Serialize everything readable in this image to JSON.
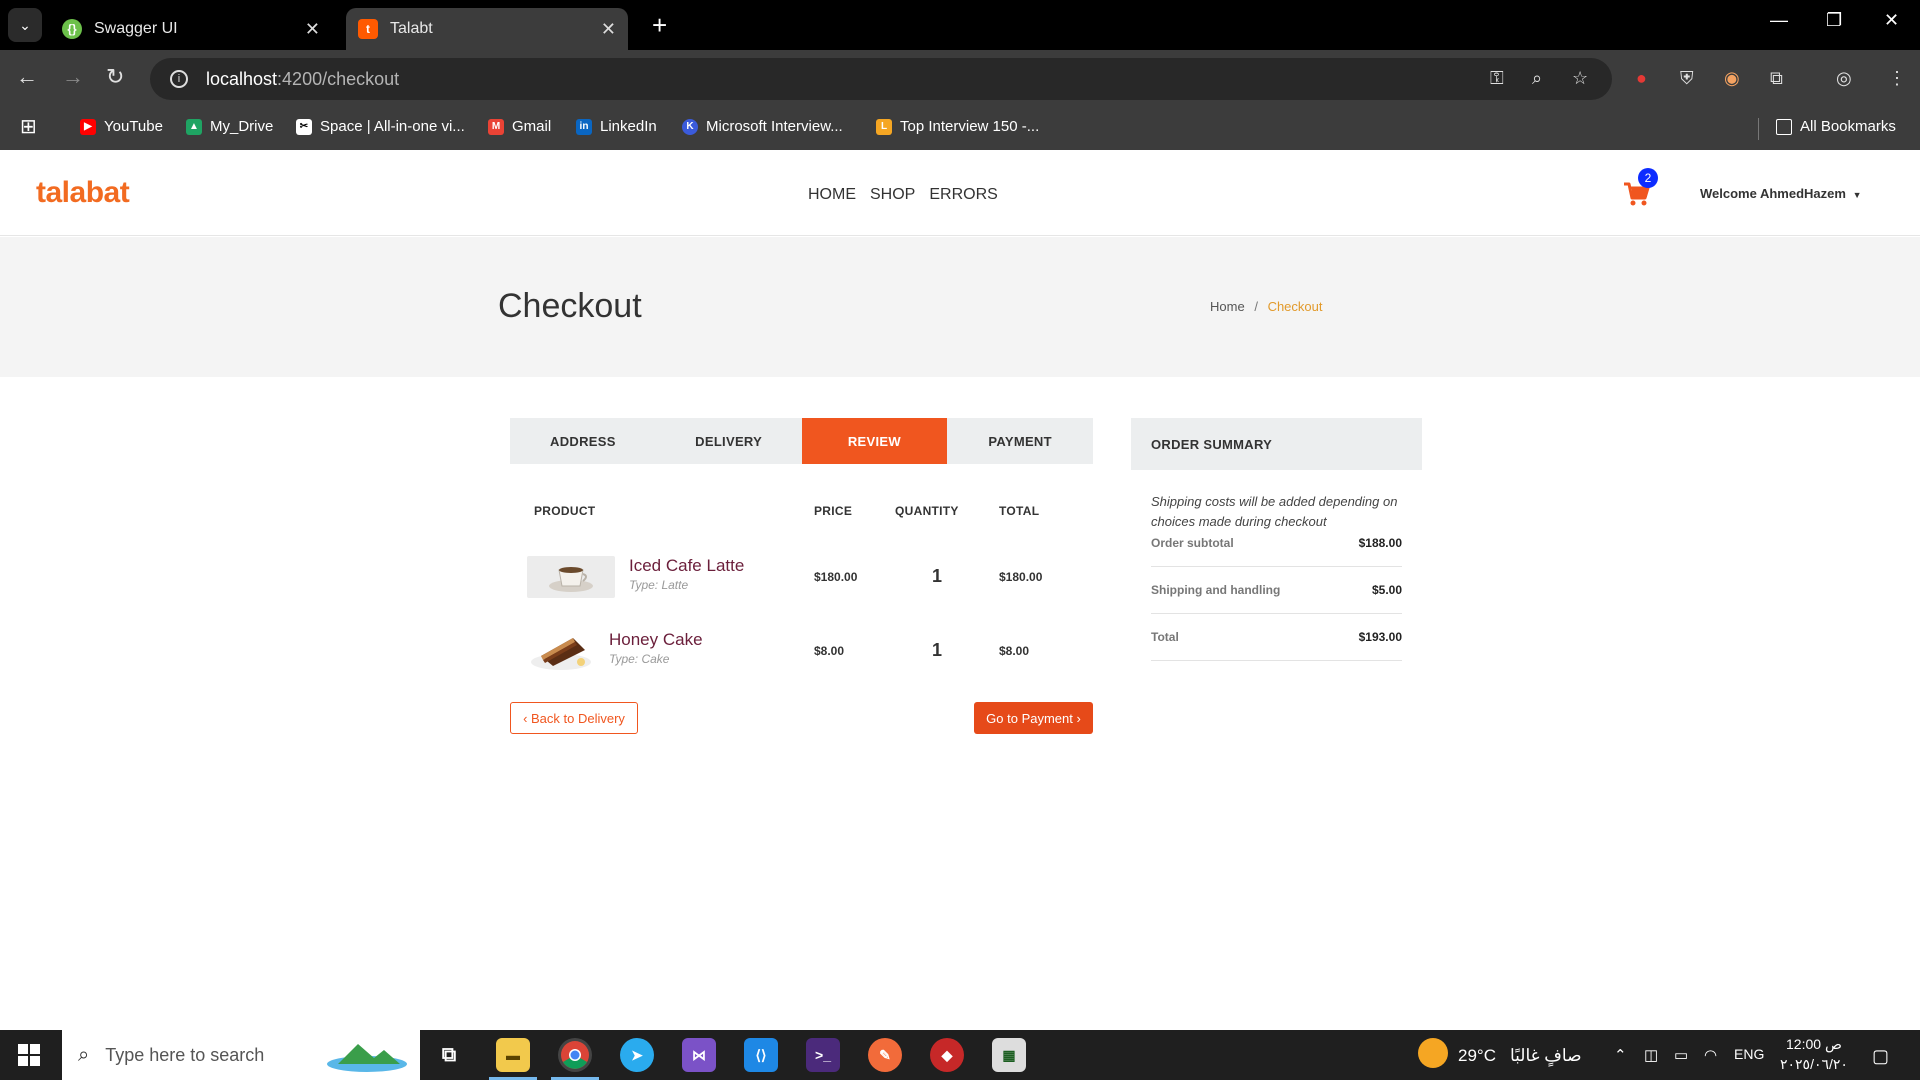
{
  "browser": {
    "tabs": [
      {
        "title": "Swagger UI",
        "active": false
      },
      {
        "title": "Talabt",
        "active": true
      }
    ],
    "url_host": "localhost",
    "url_path": ":4200/checkout",
    "bookmarks": [
      {
        "label": "YouTube",
        "color": "#ff0000"
      },
      {
        "label": "My_Drive",
        "color": "#1fa463"
      },
      {
        "label": "Space | All-in-one vi...",
        "color": "#ffffff"
      },
      {
        "label": "Gmail",
        "color": "#ea4335"
      },
      {
        "label": "LinkedIn",
        "color": "#0a66c2"
      },
      {
        "label": "Microsoft Interview...",
        "color": "#3b5bdb"
      },
      {
        "label": "Top Interview 150 -...",
        "color": "#f5a623"
      }
    ],
    "all_bookmarks": "All Bookmarks"
  },
  "site": {
    "logo": "talabat",
    "nav": [
      "HOME",
      "SHOP",
      "ERRORS"
    ],
    "cart_count": "2",
    "welcome": "Welcome AhmedHazem"
  },
  "hero": {
    "title": "Checkout",
    "breadcrumb_home": "Home",
    "breadcrumb_sep": "/",
    "breadcrumb_current": "Checkout"
  },
  "steps": [
    {
      "label": "ADDRESS",
      "active": false
    },
    {
      "label": "DELIVERY",
      "active": false
    },
    {
      "label": "REVIEW",
      "active": true
    },
    {
      "label": "PAYMENT",
      "active": false
    }
  ],
  "table": {
    "headers": {
      "product": "PRODUCT",
      "price": "PRICE",
      "quantity": "QUANTITY",
      "total": "TOTAL"
    },
    "items": [
      {
        "name": "Iced Cafe Latte",
        "type": "Type: Latte",
        "price": "$180.00",
        "quantity": "1",
        "total": "$180.00"
      },
      {
        "name": "Honey Cake",
        "type": "Type: Cake",
        "price": "$8.00",
        "quantity": "1",
        "total": "$8.00"
      }
    ]
  },
  "buttons": {
    "back": "‹ Back to Delivery",
    "next": "Go to Payment ›"
  },
  "summary": {
    "title": "ORDER SUMMARY",
    "note": "Shipping costs will be added depending on choices made during checkout",
    "rows": [
      {
        "label": "Order subtotal",
        "value": "$188.00"
      },
      {
        "label": "Shipping and handling",
        "value": "$5.00"
      },
      {
        "label": "Total",
        "value": "$193.00"
      }
    ]
  },
  "taskbar": {
    "search_placeholder": "Type here to search",
    "weather": "29°C",
    "weather_desc": "صافٍ غالبًا",
    "language": "ENG",
    "time": "12:00 ص",
    "date": "٢٠٢٥/٠٦/٢٠"
  },
  "colors": {
    "brand": "#f26b21",
    "accent": "#f0561f",
    "badge": "#0d2cff"
  }
}
